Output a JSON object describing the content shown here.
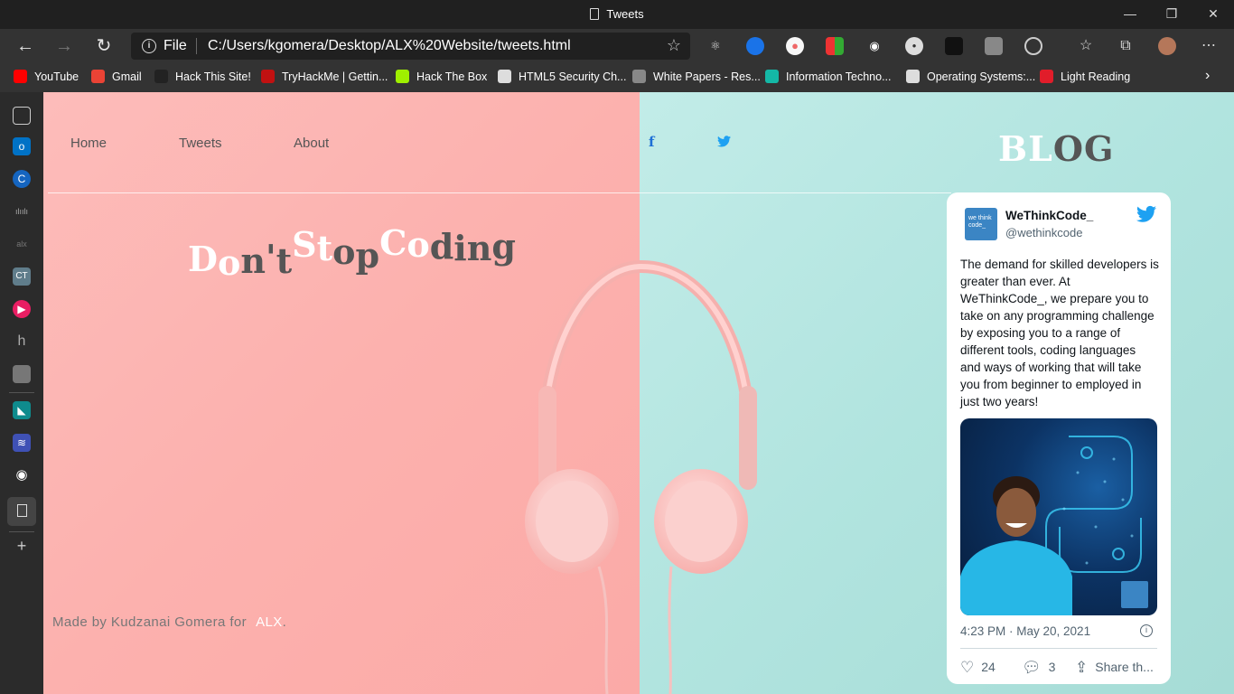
{
  "window": {
    "title": "Tweets"
  },
  "browser": {
    "file_label": "File",
    "url": "C:/Users/kgomera/Desktop/ALX%20Website/tweets.html"
  },
  "bookmarks": [
    {
      "label": "YouTube",
      "color": "#ff0000"
    },
    {
      "label": "Gmail",
      "color": "#ea4335"
    },
    {
      "label": "Hack This Site!",
      "color": "#222222"
    },
    {
      "label": "TryHackMe | Gettin...",
      "color": "#c11111"
    },
    {
      "label": "Hack The Box",
      "color": "#9fef00"
    },
    {
      "label": "HTML5 Security Ch...",
      "color": "#dddddd"
    },
    {
      "label": "White Papers - Res...",
      "color": "#888888"
    },
    {
      "label": "Information Techno...",
      "color": "#14b8a6"
    },
    {
      "label": "Operating Systems:...",
      "color": "#dddddd"
    },
    {
      "label": "Light Reading",
      "color": "#e11d2a"
    }
  ],
  "site": {
    "nav": [
      "Home",
      "Tweets",
      "About"
    ],
    "social": {
      "facebook_icon": "f",
      "twitter_icon": "🐦"
    },
    "blog": {
      "part1": "BL",
      "part2": "O",
      "part3": "G"
    },
    "hero": {
      "letters": [
        "D",
        "o",
        "n",
        "'",
        "t",
        "S",
        "t",
        "o",
        "p",
        "C",
        "o",
        "d",
        "i",
        "n",
        "g"
      ]
    },
    "footer": {
      "text": "Made by Kudzanai Gomera for",
      "link": "ALX",
      "end": "."
    }
  },
  "tweet": {
    "name": "WeThinkCode_",
    "handle": "@wethinkcode",
    "avatar_text": "we think code_",
    "text": "The demand for skilled developers is greater than ever. At WeThinkCode_, we prepare you to take on any programming challenge by exposing you to a range of different tools, coding languages and ways of working that will take you from beginner to employed in just two years!",
    "timestamp": "4:23 PM · May 20, 2021",
    "likes": "24",
    "replies": "3",
    "share": "Share th..."
  },
  "colors": {
    "left_bg": "#fdb7b4",
    "right_bg": "#b1e4df",
    "twitter_blue": "#1da1f2"
  }
}
